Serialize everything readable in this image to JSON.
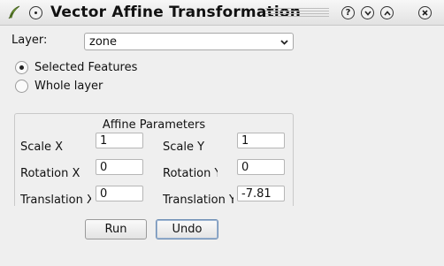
{
  "window": {
    "title": "Vector Affine Transformation",
    "controls": {
      "help": "?",
      "minimize": "⌄",
      "maximize": "⌃",
      "close": "✕"
    }
  },
  "layer": {
    "label": "Layer:",
    "selected": "zone"
  },
  "scope": {
    "options": [
      {
        "label": "Selected Features",
        "checked": true
      },
      {
        "label": "Whole layer",
        "checked": false
      }
    ]
  },
  "affine": {
    "title": "Affine Parameters",
    "scale_x": {
      "label": "Scale X",
      "value": "1"
    },
    "scale_y": {
      "label": "Scale Y",
      "value": "1"
    },
    "rotation_x": {
      "label": "Rotation X",
      "value": "0"
    },
    "rotation_y": {
      "label": "Rotation Y",
      "value": "0"
    },
    "translation_x": {
      "label": "Translation X",
      "value": "0"
    },
    "translation_y": {
      "label": "Translation Y",
      "value": "-7.81"
    }
  },
  "buttons": {
    "run": "Run",
    "undo": "Undo"
  },
  "icons": {
    "app": "feather-quill-icon",
    "menu": "window-menu-icon",
    "help": "help-icon",
    "minimize": "minimize-icon",
    "maximize": "maximize-icon",
    "close": "close-icon",
    "dropdown": "chevron-down-icon"
  },
  "colors": {
    "app_icon_fill": "#7aa43a",
    "focus_border": "#6f8fb5"
  }
}
